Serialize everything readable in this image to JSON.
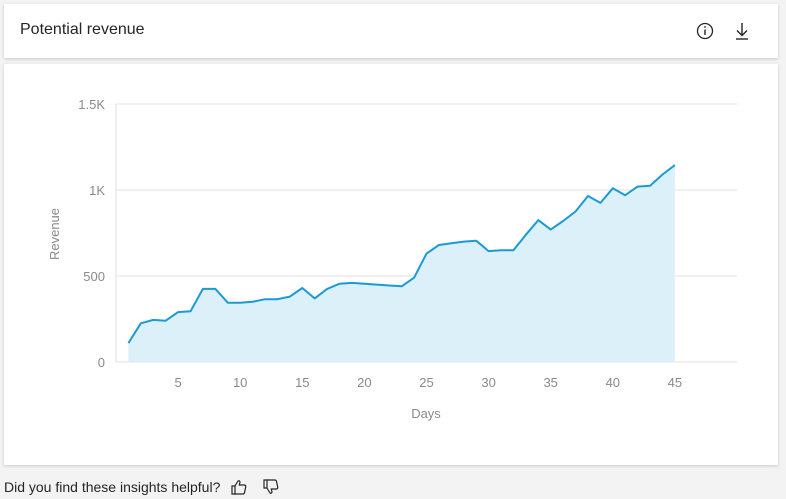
{
  "header": {
    "title": "Potential revenue",
    "info_icon": "info-icon",
    "download_icon": "download-icon"
  },
  "feedback": {
    "question": "Did you find these insights helpful?",
    "thumbs_up_icon": "thumbs-up-icon",
    "thumbs_down_icon": "thumbs-down-icon"
  },
  "colors": {
    "line": "#1a9ad6",
    "area": "#dcf0fa",
    "grid": "#e1e1e1",
    "text": "#8a8a8a"
  },
  "chart_data": {
    "type": "area",
    "title": "",
    "xlabel": "Days",
    "ylabel": "Revenue",
    "xlim": [
      0,
      50
    ],
    "ylim": [
      0,
      1500
    ],
    "x_ticks": [
      5,
      10,
      15,
      20,
      25,
      30,
      35,
      40,
      45
    ],
    "x_tick_labels": [
      "5",
      "10",
      "15",
      "20",
      "25",
      "30",
      "35",
      "40",
      "45"
    ],
    "y_ticks": [
      0,
      500,
      1000,
      1500
    ],
    "y_tick_labels": [
      "0",
      "500",
      "1K",
      "1.5K"
    ],
    "grid": "horizontal",
    "x": [
      1,
      2,
      3,
      4,
      5,
      6,
      7,
      8,
      9,
      10,
      11,
      12,
      13,
      14,
      15,
      16,
      17,
      18,
      19,
      20,
      21,
      22,
      23,
      24,
      25,
      26,
      27,
      28,
      29,
      30,
      31,
      32,
      33,
      34,
      35,
      36,
      37,
      38,
      39,
      40,
      41,
      42,
      43,
      44,
      45
    ],
    "values": [
      110,
      225,
      245,
      240,
      290,
      295,
      425,
      425,
      345,
      345,
      350,
      365,
      365,
      380,
      430,
      370,
      425,
      455,
      460,
      455,
      450,
      445,
      440,
      490,
      630,
      680,
      690,
      700,
      705,
      645,
      650,
      650,
      740,
      825,
      770,
      820,
      875,
      965,
      925,
      1010,
      970,
      1020,
      1025,
      1090,
      1145
    ]
  }
}
